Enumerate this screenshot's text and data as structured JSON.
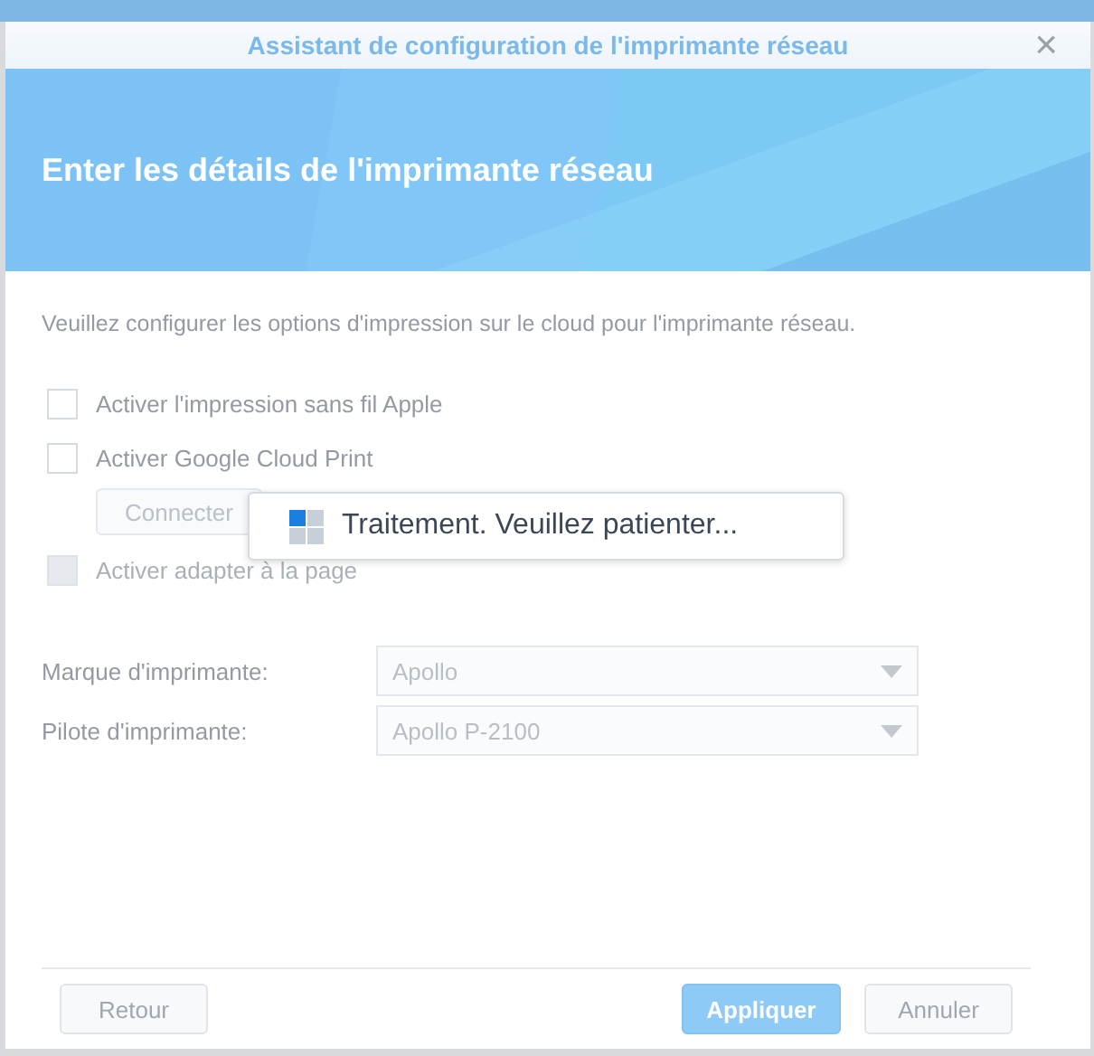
{
  "window": {
    "title": "Assistant de configuration de l'imprimante réseau",
    "close": "×"
  },
  "banner": {
    "heading": "Enter les détails de l'imprimante réseau"
  },
  "description": "Veuillez configurer les options d'impression sur le cloud pour l'imprimante réseau.",
  "options": [
    {
      "kind": "checkbox",
      "label": "Activer l'impression sans fil Apple",
      "checked": false,
      "disabled": false
    },
    {
      "kind": "checkbox",
      "label": "Activer Google Cloud Print",
      "checked": false,
      "disabled": false
    },
    {
      "kind": "button",
      "label": "Connecter",
      "disabled": true
    },
    {
      "kind": "checkbox",
      "label": "Activer adapter à la page",
      "checked": false,
      "disabled": true
    }
  ],
  "fields": [
    {
      "label": "Marque d'imprimante:",
      "value": "Apollo",
      "disabled": true
    },
    {
      "label": "Pilote d'imprimante:",
      "value": "Apollo P-2100",
      "disabled": true
    }
  ],
  "loading": {
    "message": "Traitement. Veuillez patienter..."
  },
  "buttons": [
    {
      "label": "Retour",
      "kind": "back"
    },
    {
      "label": "Appliquer",
      "kind": "primary"
    },
    {
      "label": "Annuler",
      "kind": "secondary"
    }
  ]
}
